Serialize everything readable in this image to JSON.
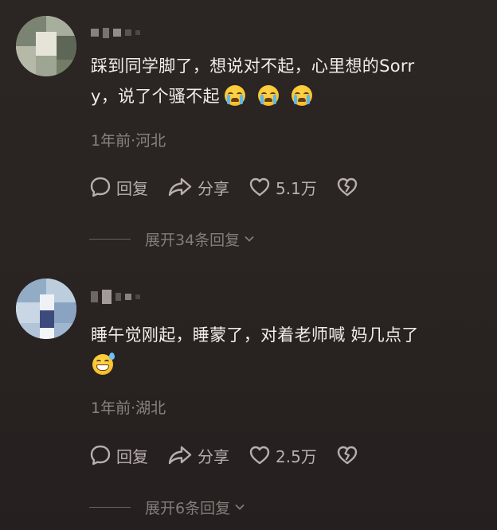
{
  "comments": [
    {
      "username_masked": "▘▝▖·",
      "text_line1": "踩到同学脚了，想说对不起，心里想的Sorr",
      "text_line2": "y，说了个骚不起",
      "emojis": [
        "loudly-crying-face",
        "loudly-crying-face",
        "loudly-crying-face"
      ],
      "meta": "1年前·河北",
      "reply_label": "回复",
      "share_label": "分享",
      "like_count": "5.1万",
      "view_replies": "展开34条回复",
      "avatar_colors": [
        "#9aa394",
        "#c6c9bd",
        "#7e876f",
        "#e8e6dc",
        "#596250",
        "#b8b9aa"
      ]
    },
    {
      "username_masked": "▘▝▖·",
      "text_line1": "睡午觉刚起，睡蒙了，对着老师喊 妈几点了",
      "emojis": [
        "grinning-face-with-sweat"
      ],
      "meta": "1年前·湖北",
      "reply_label": "回复",
      "share_label": "分享",
      "like_count": "2.5万",
      "view_replies": "展开6条回复",
      "avatar_colors": [
        "#a9c0d8",
        "#d7e2ec",
        "#8ea9c9",
        "#f1f4f7",
        "#6f88a8",
        "#3c4a7a"
      ]
    }
  ],
  "colors": {
    "background": "#2a2422",
    "text_primary": "#f1edeb",
    "text_secondary": "#8a8280",
    "action_color": "#b7afad"
  },
  "icons": [
    "comment-bubble-icon",
    "share-arrow-icon",
    "heart-icon",
    "broken-heart-icon",
    "chevron-down-icon"
  ]
}
